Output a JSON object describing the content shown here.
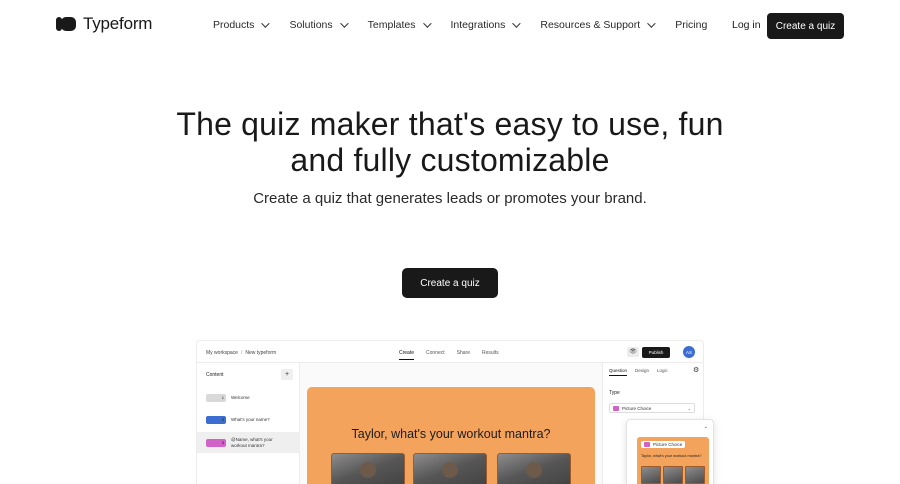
{
  "nav": {
    "brand": "Typeform",
    "items": [
      {
        "label": "Products",
        "has_dropdown": true
      },
      {
        "label": "Solutions",
        "has_dropdown": true
      },
      {
        "label": "Templates",
        "has_dropdown": true
      },
      {
        "label": "Integrations",
        "has_dropdown": true
      },
      {
        "label": "Resources & Support",
        "has_dropdown": true
      },
      {
        "label": "Pricing",
        "has_dropdown": false
      }
    ],
    "login": "Log in",
    "cta": "Create a quiz"
  },
  "hero": {
    "title": "The quiz maker that's easy to use, fun and fully customizable",
    "subtitle": "Create a quiz that generates leads or promotes your brand.",
    "cta": "Create a quiz"
  },
  "app_preview": {
    "breadcrumb": [
      "My workspace",
      "New typeform"
    ],
    "breadcrumb_sep": "/",
    "tabs": [
      "Create",
      "Connect",
      "Share",
      "Results"
    ],
    "active_tab": "Create",
    "eye_glyph": "👁",
    "publish": "Publish",
    "avatar_initials": "AS",
    "content_label": "Content",
    "add_glyph": "+",
    "questions": [
      {
        "num": "1",
        "text": "Welcome",
        "color": "#d9d9d9"
      },
      {
        "num": "2",
        "text": "What's your name?",
        "color": "#3b6ed0"
      },
      {
        "num": "3",
        "text": "@Name, what's your workout mantra?",
        "color": "#d163c8"
      }
    ],
    "canvas_question": "Taylor, what's your workout mantra?",
    "canvas_color": "#f3a35c",
    "right_tabs": [
      "Question",
      "Design",
      "Logic"
    ],
    "right_active_tab": "Question",
    "settings_icon": "gear-icon",
    "type_label": "Type",
    "type_value": "Picture Choice",
    "popup": {
      "close_glyph": "⌄",
      "label": "Picture Choice",
      "question": "Taylor, what's your workout mantra?"
    }
  },
  "colors": {
    "primary": "#191919",
    "accent_orange": "#f3a35c",
    "accent_blue": "#3b6ed0",
    "accent_pink": "#d163c8"
  }
}
